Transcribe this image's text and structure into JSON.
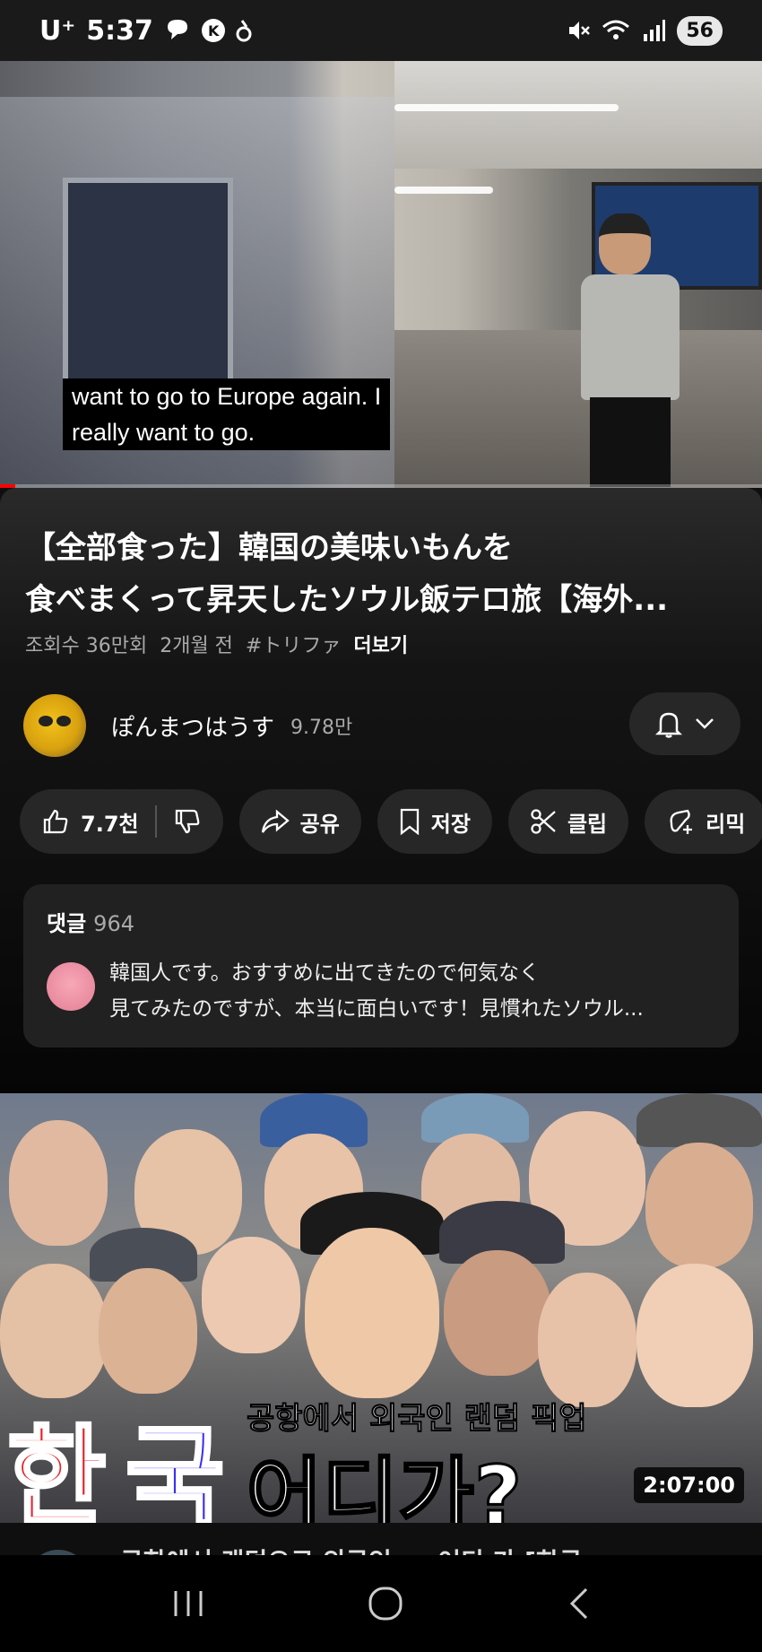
{
  "status_bar": {
    "carrier": "U⁺",
    "time": "5:37",
    "battery": "56"
  },
  "video": {
    "caption_line1": "want to go to Europe again. I",
    "caption_line2": "really want to go.",
    "progress_fraction": 0.02
  },
  "title": {
    "line1": "【全部食った】韓国の美味いもんを",
    "line2": "食べまくって昇天したソウル飯テロ旅【海外..."
  },
  "meta": {
    "views": "조회수 36만회",
    "age": "2개월 전",
    "tag": "#トリファ",
    "more": "더보기"
  },
  "channel": {
    "name": "ぽんまつはうす",
    "subscribers": "9.78만"
  },
  "actions": {
    "likes": "7.7천",
    "share": "공유",
    "save": "저장",
    "clip": "클립",
    "remix": "리믹"
  },
  "comments": {
    "label": "댓글",
    "count": "964",
    "top_comment_line1": "韓国人です。おすすめに出てきたので何気なく",
    "top_comment_line2": "見てみたのですが、本当に面白いです！見慣れたソウル..."
  },
  "next_video": {
    "thumb_sub": "공항에서 외국인 랜덤 픽업",
    "thumb_han": "한",
    "thumb_guk": "국",
    "thumb_main": "어디가?",
    "duration": "2:07:00",
    "title_partial": "공항에서 랜덤으로 외국인 ... 어디 가 [한국..."
  },
  "icons": [
    "thumbs-up-icon",
    "thumbs-down-icon",
    "share-icon",
    "bookmark-icon",
    "scissors-icon",
    "remix-icon",
    "bell-icon",
    "chevron-down-icon",
    "mute-icon",
    "wifi-icon",
    "signal-icon"
  ]
}
